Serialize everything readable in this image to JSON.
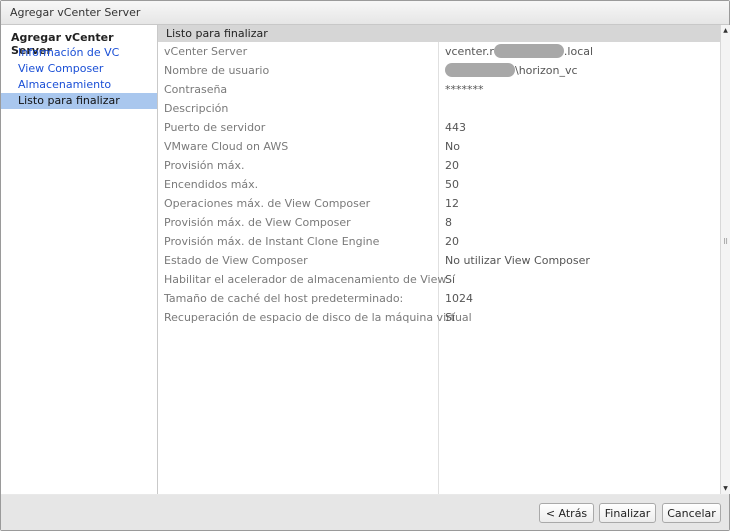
{
  "window": {
    "title": "Agregar vCenter Server"
  },
  "nav": {
    "title": "Agregar vCenter Server",
    "items": [
      {
        "label": "Información de VC"
      },
      {
        "label": "View Composer"
      },
      {
        "label": "Almacenamiento"
      },
      {
        "label": "Listo para finalizar"
      }
    ],
    "active": "Listo para finalizar"
  },
  "summary": {
    "header": "Listo para finalizar",
    "rows": [
      {
        "label": "vCenter Server",
        "value_prefix": "vcenter.r",
        "value_suffix": ".local"
      },
      {
        "label": "Nombre de usuario",
        "value_suffix": "\\horizon_vc"
      },
      {
        "label": "Contraseña",
        "value": "*******"
      },
      {
        "label": "Descripción",
        "value": ""
      },
      {
        "label": "Puerto de servidor",
        "value": "443"
      },
      {
        "label": "VMware Cloud on AWS",
        "value": "No"
      },
      {
        "label": "Provisión máx.",
        "value": "20"
      },
      {
        "label": "Encendidos máx.",
        "value": "50"
      },
      {
        "label": "Operaciones máx. de View Composer",
        "value": "12"
      },
      {
        "label": "Provisión máx. de View Composer",
        "value": "8"
      },
      {
        "label": "Provisión máx. de Instant Clone Engine",
        "value": "20"
      },
      {
        "label": "Estado de View Composer",
        "value": "No utilizar View Composer"
      },
      {
        "label": "Habilitar el acelerador de almacenamiento de View",
        "value": "Sí"
      },
      {
        "label": "Tamaño de caché del host predeterminado:",
        "value": "1024"
      },
      {
        "label": "Recuperación de espacio de disco de la máquina virtual",
        "value": "Sí"
      }
    ]
  },
  "footer": {
    "back_label": "< Atrás",
    "finish_label": "Finalizar",
    "cancel_label": "Cancelar"
  },
  "icons": {
    "scroll_up": "scroll-up-arrow-icon",
    "scroll_down": "scroll-down-arrow-icon",
    "resize": "resize-grip-icon"
  },
  "colors": {
    "nav_link": "#1a4fd6",
    "nav_active_bg": "#a9c7ee",
    "header_bg": "#d6d6d6"
  }
}
